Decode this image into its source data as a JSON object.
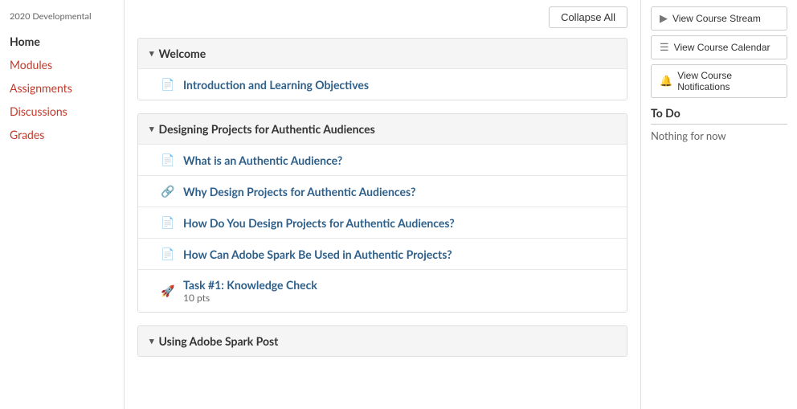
{
  "sidebar": {
    "course_label": "2020 Developmental",
    "nav_items": [
      {
        "id": "home",
        "label": "Home",
        "active": true
      },
      {
        "id": "modules",
        "label": "Modules",
        "active": false
      },
      {
        "id": "assignments",
        "label": "Assignments",
        "active": false
      },
      {
        "id": "discussions",
        "label": "Discussions",
        "active": false
      },
      {
        "id": "grades",
        "label": "Grades",
        "active": false
      }
    ]
  },
  "toolbar": {
    "collapse_all_label": "Collapse All"
  },
  "modules": [
    {
      "id": "welcome",
      "title": "Welcome",
      "items": [
        {
          "id": "intro",
          "icon": "doc",
          "title": "Introduction and Learning Objectives",
          "pts": null
        }
      ]
    },
    {
      "id": "designing",
      "title": "Designing Projects for Authentic Audiences",
      "items": [
        {
          "id": "what",
          "icon": "doc",
          "title": "What is an Authentic Audience?",
          "pts": null
        },
        {
          "id": "why",
          "icon": "link",
          "title": "Why Design Projects for Authentic Audiences?",
          "pts": null
        },
        {
          "id": "how",
          "icon": "doc",
          "title": "How Do You Design Projects for Authentic Audiences?",
          "pts": null
        },
        {
          "id": "adobe",
          "icon": "doc",
          "title": "How Can Adobe Spark Be Used in Authentic Projects?",
          "pts": null
        },
        {
          "id": "task1",
          "icon": "rocket",
          "title": "Task #1: Knowledge Check",
          "pts": "10 pts"
        }
      ]
    },
    {
      "id": "using_adobe",
      "title": "Using Adobe Spark Post",
      "items": []
    }
  ],
  "right_sidebar": {
    "buttons": [
      {
        "id": "stream",
        "icon": "▶",
        "label": "View Course Stream"
      },
      {
        "id": "calendar",
        "icon": "📅",
        "label": "View Course Calendar"
      },
      {
        "id": "notifications",
        "icon": "🔔",
        "label": "View Course Notifications"
      }
    ],
    "todo": {
      "title": "To Do",
      "empty_text": "Nothing for now"
    }
  }
}
